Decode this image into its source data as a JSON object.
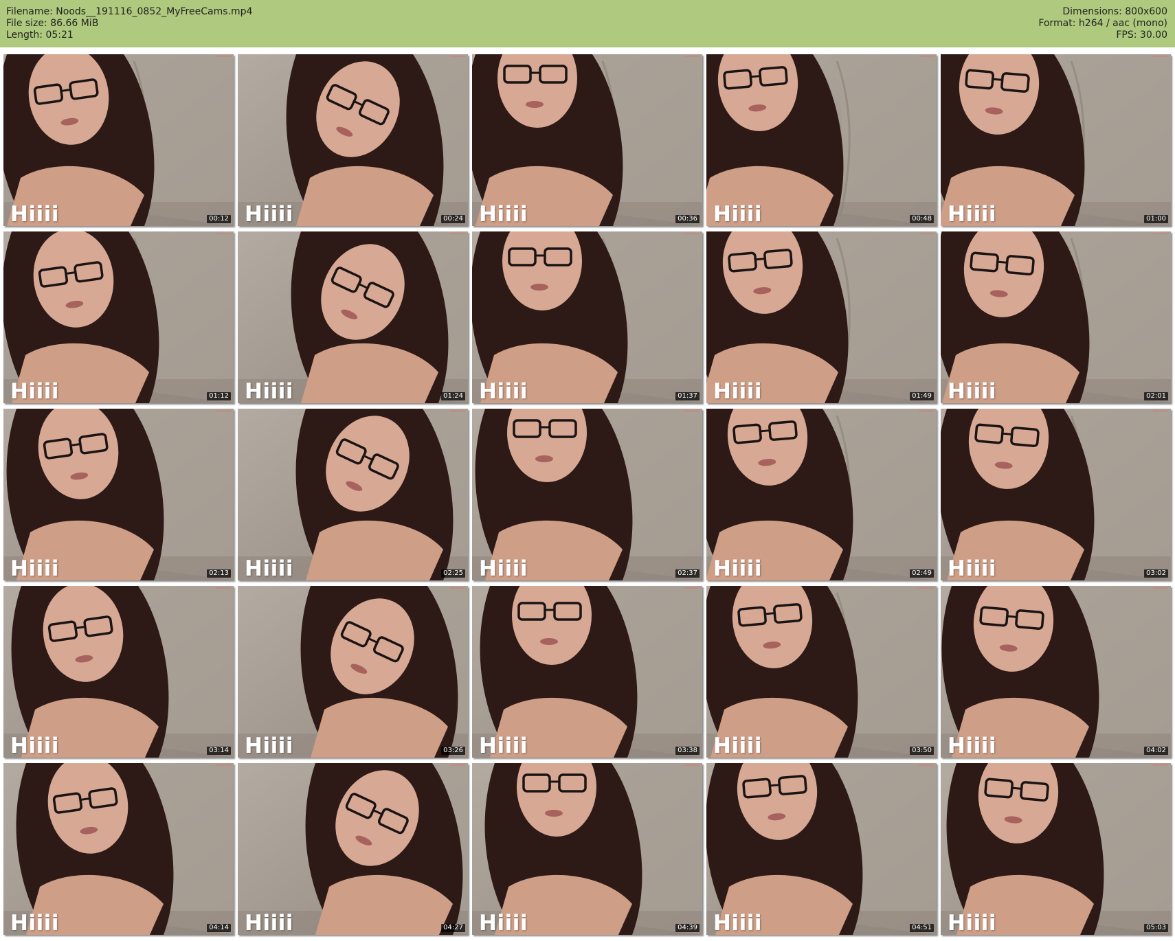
{
  "header": {
    "left": [
      "Filename: Noods__191116_0852_MyFreeCams.mp4",
      "File size: 86.66 MiB",
      "Length: 05:21"
    ],
    "right": [
      "Dimensions: 800x600",
      "Format: h264 / aac (mono)",
      "FPS: 30.00"
    ]
  },
  "colors": {
    "header_bg": "#afc97e",
    "page_bg": "#ffffff",
    "timestamp_bg": "#000000"
  },
  "overlay_text": "Hiiii",
  "thumbnails": [
    {
      "time": "00:12"
    },
    {
      "time": "00:24"
    },
    {
      "time": "00:36"
    },
    {
      "time": "00:48"
    },
    {
      "time": "01:00"
    },
    {
      "time": "01:12"
    },
    {
      "time": "01:24"
    },
    {
      "time": "01:37"
    },
    {
      "time": "01:49"
    },
    {
      "time": "02:01"
    },
    {
      "time": "02:13"
    },
    {
      "time": "02:25"
    },
    {
      "time": "02:37"
    },
    {
      "time": "02:49"
    },
    {
      "time": "03:02"
    },
    {
      "time": "03:14"
    },
    {
      "time": "03:26"
    },
    {
      "time": "03:38"
    },
    {
      "time": "03:50"
    },
    {
      "time": "04:02"
    },
    {
      "time": "04:14"
    },
    {
      "time": "04:27"
    },
    {
      "time": "04:39"
    },
    {
      "time": "04:51"
    },
    {
      "time": "05:03"
    }
  ]
}
